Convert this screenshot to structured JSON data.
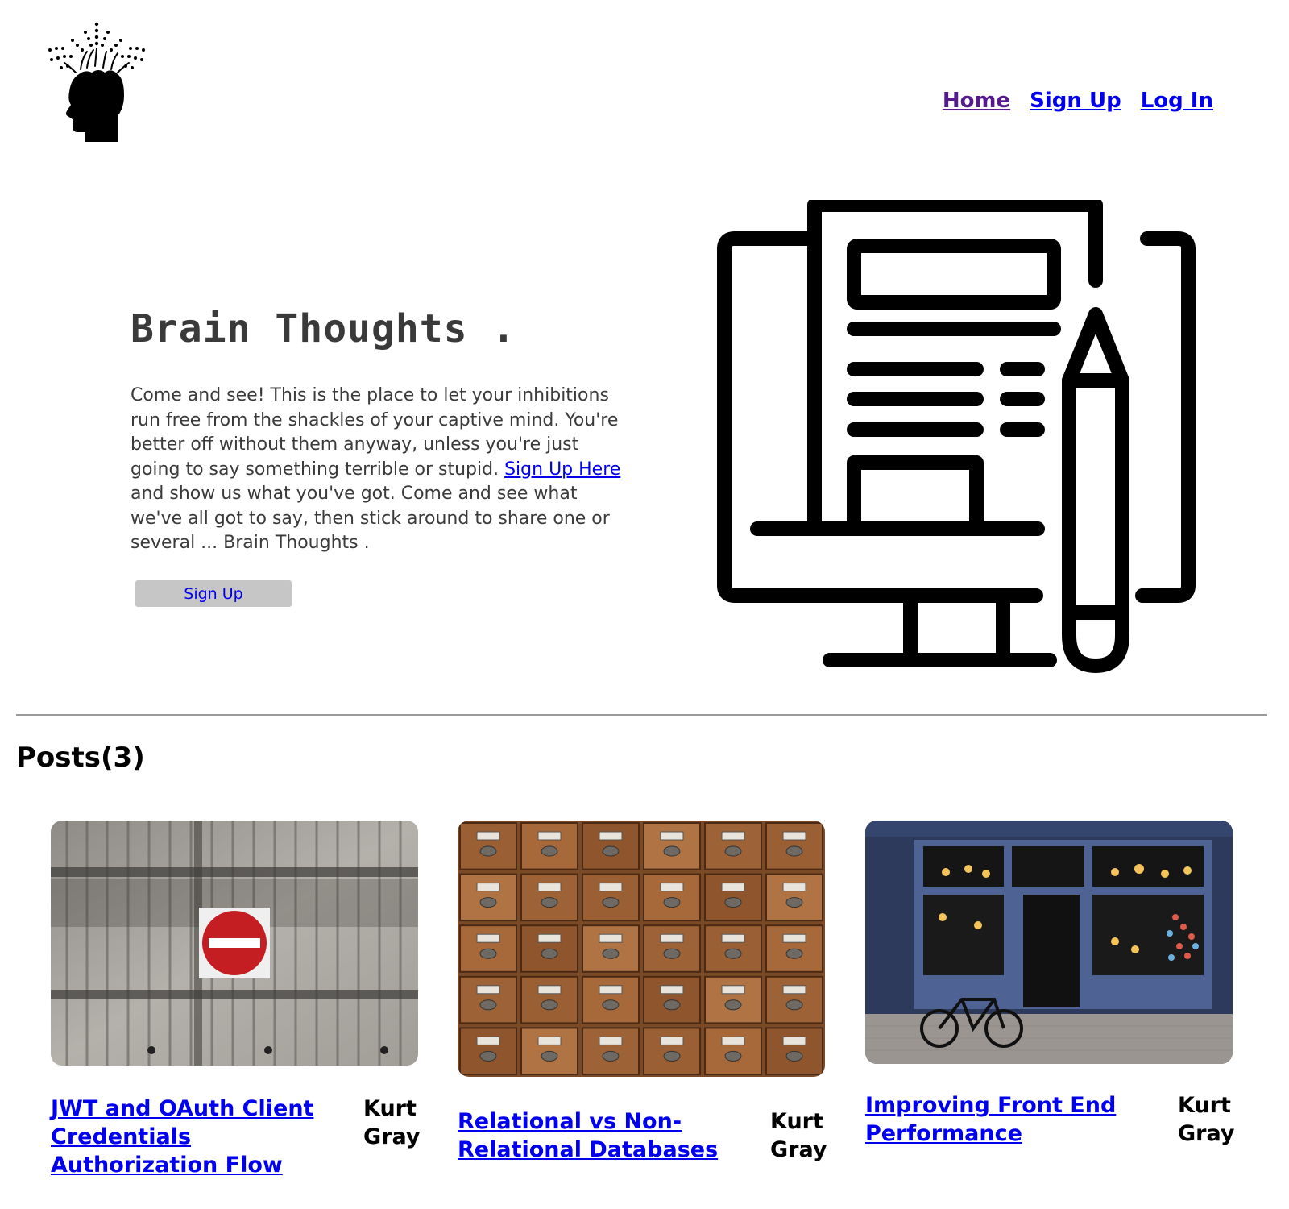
{
  "header": {
    "nav": [
      {
        "label": "Home"
      },
      {
        "label": "Sign Up"
      },
      {
        "label": "Log In"
      }
    ]
  },
  "hero": {
    "title": "Brain Thoughts .",
    "desc_part1": "Come and see! This is the place to let your inhibitions run free from the shackles of your captive mind. You're better off without them anyway, unless you're just going to say something terrible or stupid.",
    "desc_link": "Sign Up Here",
    "desc_part2": "and show us what you've got. Come and see what we've all got to say, then stick around to share one or several ... Brain Thoughts .",
    "button_label": "Sign Up"
  },
  "posts": {
    "heading": "Posts(3)",
    "items": [
      {
        "title": "JWT and OAuth Client Credentials Authorization Flow",
        "author": "Kurt Gray",
        "image": "do-not-enter-sign-on-concrete-wall"
      },
      {
        "title": "Relational vs Non-Relational Databases",
        "author": "Kurt Gray",
        "image": "wooden-card-catalog-drawers"
      },
      {
        "title": "Improving Front End Performance",
        "author": "Kurt Gray",
        "image": "storefront-with-bicycle"
      }
    ]
  },
  "colors": {
    "link": "#0000ee",
    "visited_link": "#551a8b",
    "hero_text": "#3a3a3a",
    "button_bg": "#c6c6c6",
    "divider": "#9a9a9a"
  }
}
